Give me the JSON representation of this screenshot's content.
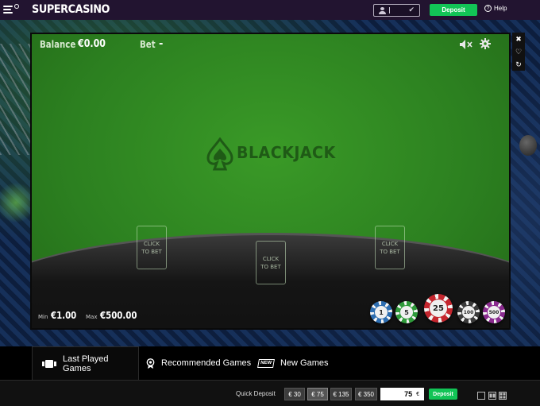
{
  "topbar": {
    "logo": "SUPERCASINO",
    "user_value": "",
    "deposit_label": "Deposit",
    "help_label": "Help"
  },
  "game": {
    "balance_label": "Balance",
    "balance_value": "€0.00",
    "bet_label": "Bet",
    "bet_value": "-",
    "logo_text": "BLACKJACK",
    "spots": [
      "CLICK\nTO BET",
      "CLICK\nTO BET",
      "CLICK\nTO BET"
    ],
    "min_label": "Min",
    "min_value": "€1.00",
    "max_label": "Max",
    "max_value": "€500.00",
    "chips": [
      {
        "value": "1",
        "color": "#2d6db0"
      },
      {
        "value": "5",
        "color": "#2f9a3a"
      },
      {
        "value": "25",
        "color": "#c4262e"
      },
      {
        "value": "100",
        "color": "#3a3a3a"
      },
      {
        "value": "500",
        "color": "#8a2b8f"
      }
    ]
  },
  "side_controls": [
    "close-icon",
    "heart-icon",
    "refresh-icon"
  ],
  "tabs": [
    {
      "label": "Last Played Games",
      "icon": "card-icon",
      "active": true
    },
    {
      "label": "Recommended Games",
      "icon": "medal-icon",
      "active": false
    },
    {
      "label": "New Games",
      "icon": "new-badge-icon",
      "badge": "NEW",
      "active": false
    }
  ],
  "quick_deposit": {
    "label": "Quick Deposit",
    "amounts": [
      "€ 30",
      "€ 75",
      "€ 135",
      "€ 350"
    ],
    "selected": "€ 75",
    "input_value": "75",
    "currency": "€",
    "deposit_label": "Deposit"
  },
  "colors": {
    "accent_green": "#12c456",
    "topbar": "#221430",
    "felt": "#2f8a20"
  }
}
